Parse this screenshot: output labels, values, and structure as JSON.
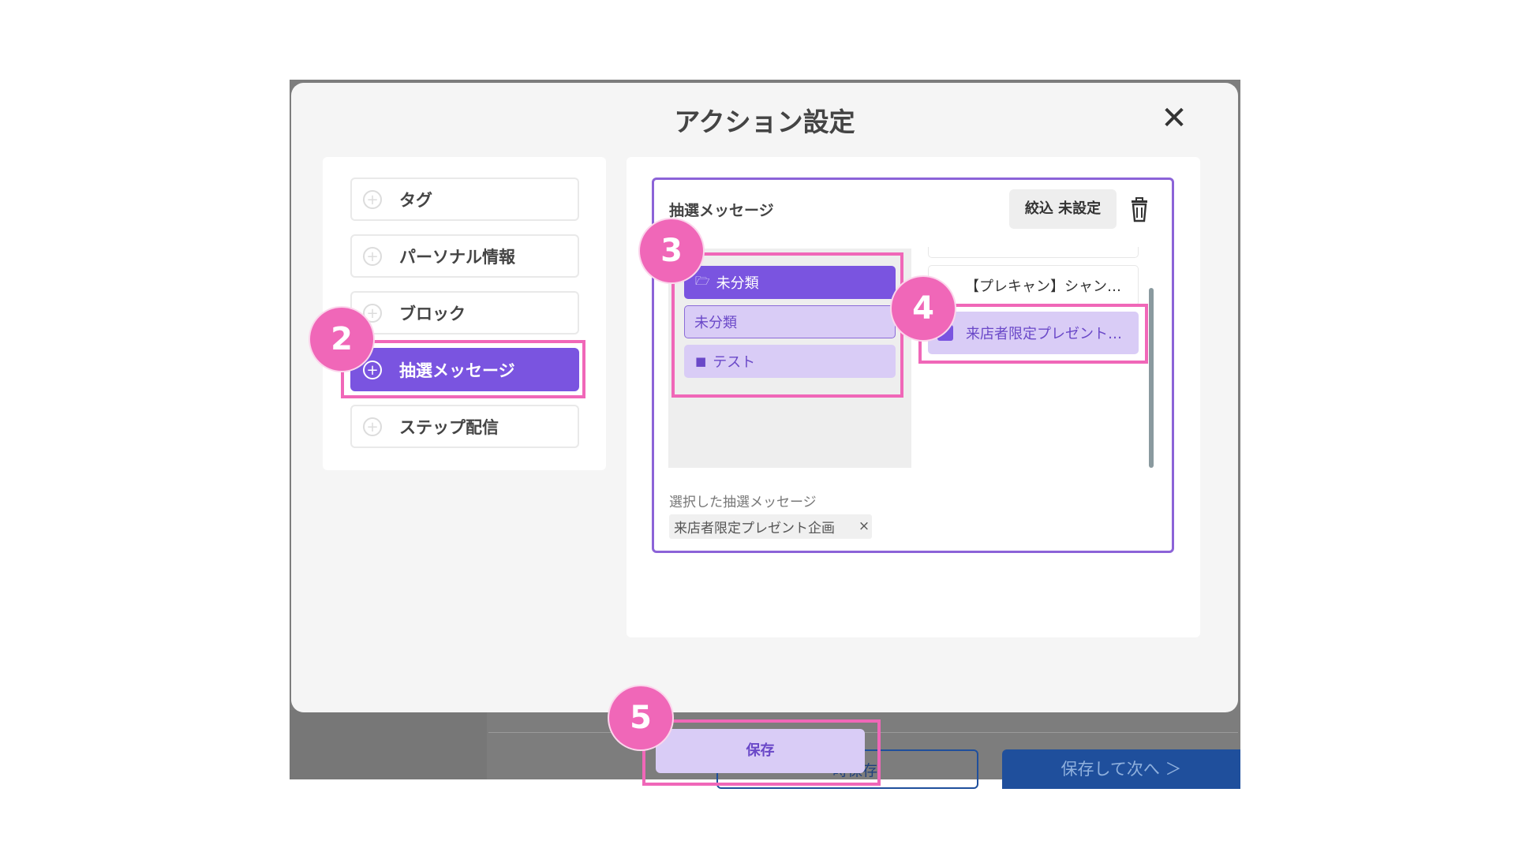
{
  "background": {
    "temp_save_label": "一時保存",
    "save_next_label": "保存して次へ ＞"
  },
  "modal": {
    "title": "アクション設定",
    "close_icon": "close-icon"
  },
  "categories": [
    {
      "label": "タグ",
      "icon": "plus-circle-icon",
      "active": false
    },
    {
      "label": "パーソナル情報",
      "icon": "plus-circle-icon",
      "active": false
    },
    {
      "label": "ブロック",
      "icon": "plus-circle-icon",
      "active": false
    },
    {
      "label": "抽選メッセージ",
      "icon": "plus-circle-icon",
      "active": true
    },
    {
      "label": "ステップ配信",
      "icon": "plus-circle-icon",
      "active": false
    }
  ],
  "lottery": {
    "title": "抽選メッセージ",
    "filter_label": "絞込 未設定",
    "trash_icon": "trash-icon",
    "folders": [
      {
        "label": "未分類",
        "icon": "folder-open-icon",
        "state": "open"
      },
      {
        "label": "未分類",
        "icon": "",
        "state": "selected"
      },
      {
        "label": "テスト",
        "icon": "folder-icon",
        "state": "closed"
      }
    ],
    "messages": [
      {
        "label": "【プレキャン】シャン…",
        "checked": false
      },
      {
        "label": "来店者限定プレゼント…",
        "checked": true
      }
    ],
    "selected_label": "選択した抽選メッセージ",
    "selected_value": "来店者限定プレゼント企画"
  },
  "footer": {
    "save_label": "保存"
  },
  "annotations": {
    "accent_color": "#f067b8",
    "steps": [
      "2",
      "3",
      "4",
      "5"
    ]
  },
  "colors": {
    "primary": "#7a54e0",
    "primary_light": "#d9ccf6",
    "navy": "#1f4f9c"
  }
}
